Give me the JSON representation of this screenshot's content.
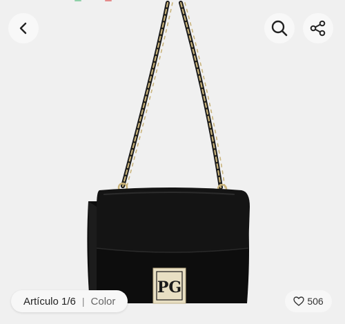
{
  "header": {
    "back_icon": "chevron-left-icon",
    "search_icon": "search-icon",
    "share_icon": "share-icon"
  },
  "product": {
    "image_description_icon": "handbag-image",
    "clasp_logo": "PG"
  },
  "footer": {
    "article_label": "Artículo 1/6",
    "separator": "|",
    "color_label": "Color",
    "likes_count": "506",
    "likes_icon": "heart-icon"
  },
  "colors": {
    "bag": "#111111",
    "background": "#f0f0f0",
    "chain_gold": "#c9b37a",
    "clasp_gold": "#e8dfc3"
  }
}
